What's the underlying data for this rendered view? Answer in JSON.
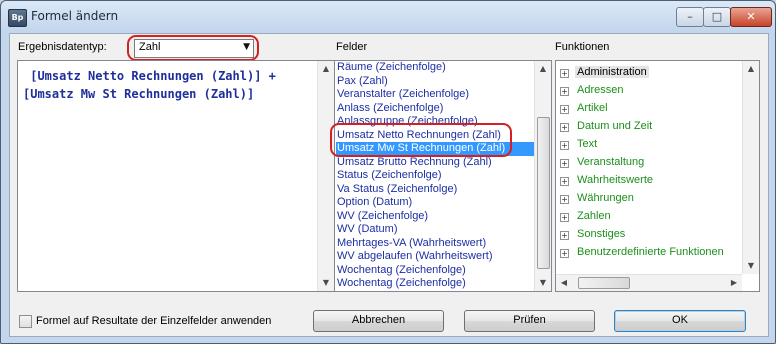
{
  "window": {
    "title": "Formel ändern",
    "app_icon_text": "Bp",
    "minimize": "–",
    "maximize": "□",
    "close": "✕"
  },
  "result_type": {
    "label": "Ergebnisdatentyp:",
    "selected": "Zahl"
  },
  "formula": {
    "text": " [Umsatz Netto Rechnungen (Zahl)] + [Umsatz Mw St Rechnungen (Zahl)]"
  },
  "fields": {
    "label": "Felder",
    "items": [
      "Räume (Zeichenfolge)",
      "Pax (Zahl)",
      "Veranstalter (Zeichenfolge)",
      "Anlass (Zeichenfolge)",
      "Anlassgruppe (Zeichenfolge)",
      "Umsatz Netto Rechnungen (Zahl)",
      "Umsatz Mw St Rechnungen (Zahl)",
      "Umsatz Brutto Rechnung (Zahl)",
      "Status (Zeichenfolge)",
      "Va Status (Zeichenfolge)",
      "Option (Datum)",
      "WV (Zeichenfolge)",
      "WV (Datum)",
      "Mehrtages-VA (Wahrheitswert)",
      "WV abgelaufen (Wahrheitswert)",
      "Wochentag (Zeichenfolge)",
      "Wochentag (Zeichenfolge)"
    ],
    "selected_index": 6
  },
  "functions": {
    "label": "Funktionen",
    "items": [
      "Administration",
      "Adressen",
      "Artikel",
      "Datum und Zeit",
      "Text",
      "Veranstaltung",
      "Wahrheitswerte",
      "Währungen",
      "Zahlen",
      "Sonstiges",
      "Benutzerdefinierte Funktionen"
    ]
  },
  "footer": {
    "checkbox_label": "Formel auf Resultate der Einzelfelder anwenden",
    "checkbox_checked": false,
    "cancel": "Abbrechen",
    "check": "Prüfen",
    "ok": "OK"
  },
  "colors": {
    "field_text": "#1c2fa3",
    "function_text": "#1c8f1c",
    "selection": "#3399ff",
    "annotation": "#d42020"
  }
}
